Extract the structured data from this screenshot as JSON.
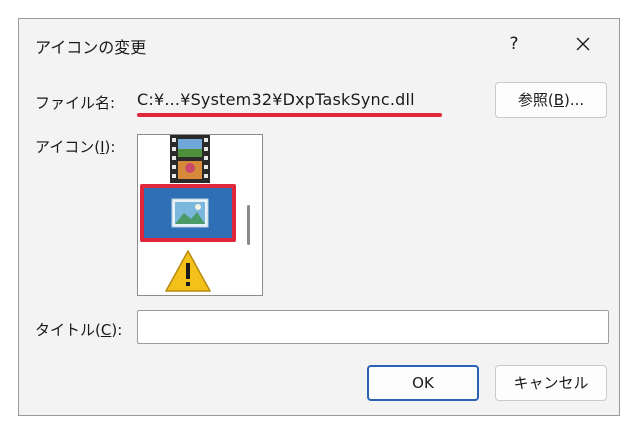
{
  "dialog": {
    "title": "アイコンの変更",
    "help_glyph": "?",
    "close_icon": "close-icon"
  },
  "file": {
    "label_prefix": "ファイル名:",
    "path": "C:¥...¥System32¥DxpTaskSync.dll",
    "browse_prefix": "参照(",
    "browse_key": "B",
    "browse_suffix": ")..."
  },
  "icons": {
    "label_prefix": "アイコン(",
    "label_key": "I",
    "label_suffix": "):",
    "items": [
      "film-strip-icon",
      "picture-icon",
      "warning-icon"
    ],
    "selected_index": 1
  },
  "title_field": {
    "label_prefix": "タイトル(",
    "label_key": "C",
    "label_suffix": "):",
    "value": ""
  },
  "buttons": {
    "ok": "OK",
    "cancel": "キャンセル"
  },
  "colors": {
    "highlight": "#e0263a",
    "selection": "#2f6fb5",
    "default_button_border": "#2b63b4"
  }
}
